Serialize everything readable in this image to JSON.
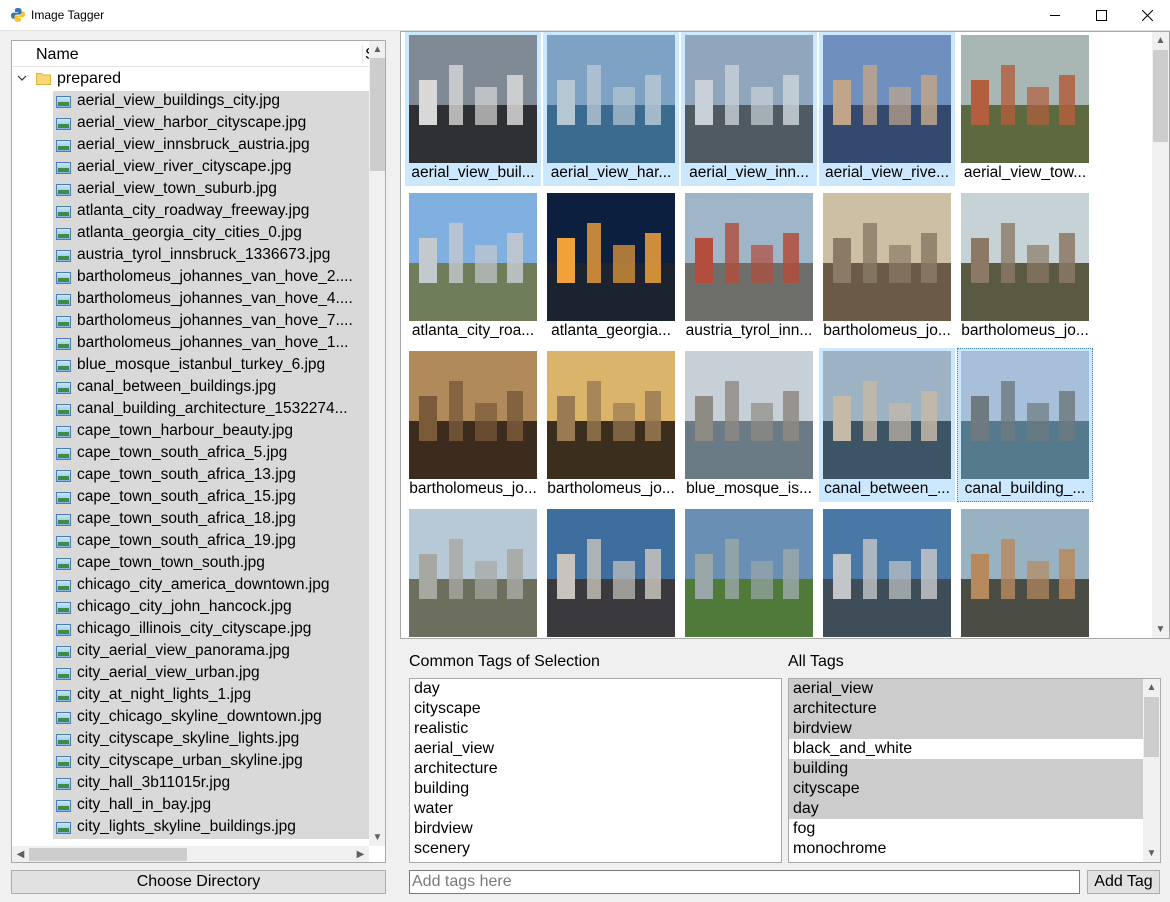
{
  "window": {
    "title": "Image Tagger",
    "controls": [
      "minimize",
      "maximize",
      "close"
    ]
  },
  "tree": {
    "header_name": "Name",
    "header_size": "S",
    "folder": "prepared",
    "files": [
      "aerial_view_buildings_city.jpg",
      "aerial_view_harbor_cityscape.jpg",
      "aerial_view_innsbruck_austria.jpg",
      "aerial_view_river_cityscape.jpg",
      "aerial_view_town_suburb.jpg",
      "atlanta_city_roadway_freeway.jpg",
      "atlanta_georgia_city_cities_0.jpg",
      "austria_tyrol_innsbruck_1336673.jpg",
      "bartholomeus_johannes_van_hove_2....",
      "bartholomeus_johannes_van_hove_4....",
      "bartholomeus_johannes_van_hove_7....",
      "bartholomeus_johannes_van_hove_1...",
      "blue_mosque_istanbul_turkey_6.jpg",
      "canal_between_buildings.jpg",
      "canal_building_architecture_1532274...",
      "cape_town_harbour_beauty.jpg",
      "cape_town_south_africa_5.jpg",
      "cape_town_south_africa_13.jpg",
      "cape_town_south_africa_15.jpg",
      "cape_town_south_africa_18.jpg",
      "cape_town_south_africa_19.jpg",
      "cape_town_town_south.jpg",
      "chicago_city_america_downtown.jpg",
      "chicago_city_john_hancock.jpg",
      "chicago_illinois_city_cityscape.jpg",
      "city_aerial_view_panorama.jpg",
      "city_aerial_view_urban.jpg",
      "city_at_night_lights_1.jpg",
      "city_chicago_skyline_downtown.jpg",
      "city_cityscape_skyline_lights.jpg",
      "city_cityscape_urban_skyline.jpg",
      "city_hall_3b11015r.jpg",
      "city_hall_in_bay.jpg",
      "city_lights_skyline_buildings.jpg"
    ]
  },
  "choose_directory": "Choose Directory",
  "grid": {
    "rows": [
      [
        {
          "caption": "aerial_view_buil...",
          "selected": true,
          "sky": "#7f8a95",
          "ground": "#2f3034",
          "accent": "#d8d8d8"
        },
        {
          "caption": "aerial_view_har...",
          "selected": true,
          "sky": "#7ea2c4",
          "ground": "#3b6b8e",
          "accent": "#b6c7d4"
        },
        {
          "caption": "aerial_view_inn...",
          "selected": true,
          "sky": "#8fa6bd",
          "ground": "#4f5a63",
          "accent": "#c9d1d8"
        },
        {
          "caption": "aerial_view_rive...",
          "selected": true,
          "sky": "#6f8fbf",
          "ground": "#334a6e",
          "accent": "#c1a58a"
        },
        {
          "caption": "aerial_view_tow...",
          "selected": false,
          "sky": "#a8b6b4",
          "ground": "#5d6a3f",
          "accent": "#b35e3c"
        }
      ],
      [
        {
          "caption": "atlanta_city_roa...",
          "selected": false,
          "sky": "#7fb0df",
          "ground": "#6f7d5a",
          "accent": "#c4c9ce"
        },
        {
          "caption": "atlanta_georgia...",
          "selected": false,
          "sky": "#0d1f3f",
          "ground": "#1b2230",
          "accent": "#f0a13a"
        },
        {
          "caption": "austria_tyrol_inn...",
          "selected": false,
          "sky": "#9fb6c9",
          "ground": "#6e6e6a",
          "accent": "#b24c3c"
        },
        {
          "caption": "bartholomeus_jo...",
          "selected": false,
          "sky": "#cdbfa3",
          "ground": "#6b5a45",
          "accent": "#8a7a66"
        },
        {
          "caption": "bartholomeus_jo...",
          "selected": false,
          "sky": "#c7d2d7",
          "ground": "#5a5a42",
          "accent": "#8b7966"
        }
      ],
      [
        {
          "caption": "bartholomeus_jo...",
          "selected": false,
          "sky": "#b08a5a",
          "ground": "#3d2c1e",
          "accent": "#7b5a3a"
        },
        {
          "caption": "bartholomeus_jo...",
          "selected": false,
          "sky": "#d9b46a",
          "ground": "#3c2e1c",
          "accent": "#9a7a52"
        },
        {
          "caption": "blue_mosque_is...",
          "selected": false,
          "sky": "#c7d0d6",
          "ground": "#6b7b86",
          "accent": "#8e8a84"
        },
        {
          "caption": "canal_between_...",
          "selected": true,
          "sky": "#9db2c2",
          "ground": "#3d5465",
          "accent": "#c5b9a7"
        },
        {
          "caption": "canal_building_...",
          "selected": true,
          "focused": true,
          "sky": "#a7bfd8",
          "ground": "#557a8b",
          "accent": "#6e7a80"
        }
      ],
      [
        {
          "caption": "",
          "selected": false,
          "sky": "#b7c9d6",
          "ground": "#6d6f5e",
          "accent": "#a7a8a2"
        },
        {
          "caption": "",
          "selected": false,
          "sky": "#3e6e9e",
          "ground": "#3a3a3e",
          "accent": "#c8c4bd"
        },
        {
          "caption": "",
          "selected": false,
          "sky": "#6a8fb4",
          "ground": "#4f7a3a",
          "accent": "#9aa7a8"
        },
        {
          "caption": "",
          "selected": false,
          "sky": "#4a78a6",
          "ground": "#3f4d58",
          "accent": "#c3c6c8"
        },
        {
          "caption": "",
          "selected": false,
          "sky": "#98b2c2",
          "ground": "#4b4d45",
          "accent": "#b78a5e"
        }
      ]
    ]
  },
  "common_tags": {
    "label": "Common Tags of Selection",
    "items": [
      "day",
      "cityscape",
      "realistic",
      "aerial_view",
      "architecture",
      "building",
      "water",
      "birdview",
      "scenery"
    ]
  },
  "all_tags": {
    "label": "All Tags",
    "items": [
      {
        "text": "aerial_view",
        "selected": true
      },
      {
        "text": "architecture",
        "selected": true
      },
      {
        "text": "birdview",
        "selected": true
      },
      {
        "text": "black_and_white",
        "selected": false
      },
      {
        "text": "building",
        "selected": true
      },
      {
        "text": "cityscape",
        "selected": true
      },
      {
        "text": "day",
        "selected": true
      },
      {
        "text": "fog",
        "selected": false
      },
      {
        "text": "monochrome",
        "selected": false
      }
    ]
  },
  "tag_input": {
    "placeholder": "Add tags here",
    "value": ""
  },
  "add_tag": "Add Tag",
  "colors": {
    "selection_tile": "#cce8ff",
    "selection_row": "#d9d9d9",
    "accent": "#3c7fb1"
  }
}
